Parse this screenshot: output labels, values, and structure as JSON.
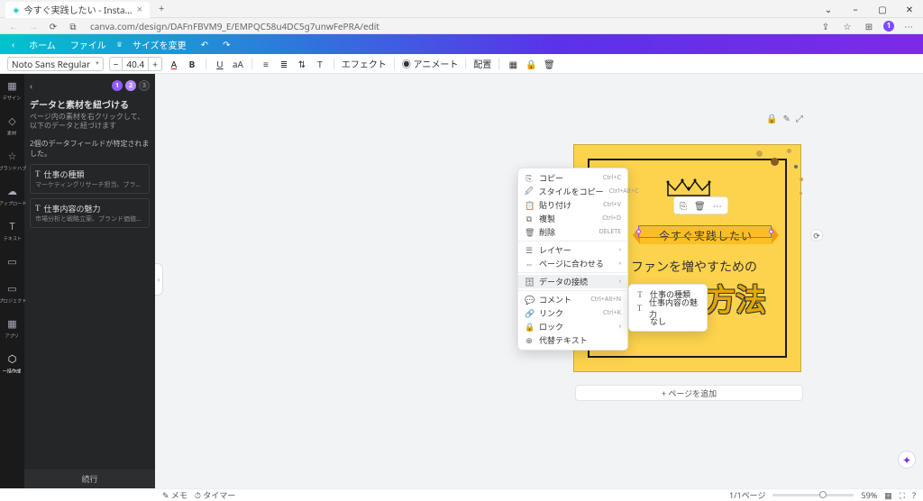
{
  "browser": {
    "tab_title": "今すぐ実践したい - Instagramの投",
    "tab_close": "×",
    "new_tab": "+",
    "url": "canva.com/design/DAFnFBVM9_E/EMPQC58u4DC5g7unwFePRA/edit",
    "profile_initial": "1",
    "win": {
      "min": "–",
      "max": "▢",
      "close": "✕"
    }
  },
  "canva_header": {
    "back": "‹",
    "home": "ホーム",
    "file": "ファイル",
    "resize": "サイズを変更",
    "undo": "↶",
    "redo": "↷"
  },
  "toolbar": {
    "font": "Noto Sans Regular",
    "minus": "−",
    "size": "40.4",
    "plus": "+",
    "color": "A",
    "bold": "B",
    "underline": "U",
    "case": "aA",
    "align": "≡",
    "list": "≣",
    "spacing": "⇅",
    "vtext": "T",
    "effect": "エフェクト",
    "animate": "アニメート",
    "position": "配置",
    "transparent": "▦",
    "lock": "🔒",
    "trash": "🗑"
  },
  "rail": {
    "items": [
      {
        "icon": "▦",
        "label": "デザイン"
      },
      {
        "icon": "◇",
        "label": "素材"
      },
      {
        "icon": "☆",
        "label": "ブランドハブ"
      },
      {
        "icon": "☁",
        "label": "アップロード"
      },
      {
        "icon": "T",
        "label": "テキスト"
      },
      {
        "icon": "▭",
        "label": ""
      },
      {
        "icon": "▭",
        "label": "プロジェクト"
      },
      {
        "icon": "▦",
        "label": "アプリ"
      },
      {
        "icon": "⬡",
        "label": "一括作成"
      }
    ]
  },
  "panel": {
    "back": "‹",
    "steps": [
      "1",
      "2",
      "3"
    ],
    "title": "データと素材を紐づける",
    "desc": "ページ内の素材を右クリックして、以下のデータと紐づけます",
    "confirmed": "2個のデータフィールドが特定されました。",
    "items": [
      {
        "title": "仕事の種類",
        "sub": "マーケティングリサーチ担当、ブランドマネージャー、デ…"
      },
      {
        "title": "仕事内容の魅力",
        "sub": "市場分析と戦略立案、ブランド価値の向上、オンライン広…"
      }
    ],
    "footer": "続行"
  },
  "canvas": {
    "ribbon": "今すぐ実践したい",
    "line2": "ファンを増やすための",
    "line3": "方法",
    "addpage": "+ ページを追加",
    "page_icons": [
      "🔒",
      "✎",
      "⤢"
    ],
    "elem_icons": [
      "⎘",
      "🗑",
      "⋯"
    ],
    "refresh": "⟳",
    "collapse": "‹"
  },
  "context_menu": {
    "items": [
      {
        "icon": "⎘",
        "label": "コピー",
        "shortcut": "Ctrl+C"
      },
      {
        "icon": "🖉",
        "label": "スタイルをコピー",
        "shortcut": "Ctrl+Alt+C"
      },
      {
        "icon": "📋",
        "label": "貼り付け",
        "shortcut": "Ctrl+V"
      },
      {
        "icon": "⧉",
        "label": "複製",
        "shortcut": "Ctrl+D"
      },
      {
        "icon": "🗑",
        "label": "削除",
        "shortcut": "DELETE"
      }
    ],
    "items2": [
      {
        "icon": "☰",
        "label": "レイヤー",
        "arrow": "›"
      },
      {
        "icon": "⇔",
        "label": "ページに合わせる",
        "arrow": "›"
      }
    ],
    "active": {
      "icon": "🗄",
      "label": "データの接続",
      "arrow": "›"
    },
    "items3": [
      {
        "icon": "💬",
        "label": "コメント",
        "shortcut": "Ctrl+Alt+N"
      },
      {
        "icon": "🔗",
        "label": "リンク",
        "shortcut": "Ctrl+K"
      },
      {
        "icon": "🔒",
        "label": "ロック",
        "arrow": "›"
      },
      {
        "icon": "⊕",
        "label": "代替テキスト"
      }
    ]
  },
  "submenu": {
    "items": [
      {
        "icon": "T",
        "label": "仕事の種類"
      },
      {
        "icon": "T",
        "label": "仕事内容の魅力"
      },
      {
        "label": "なし"
      }
    ]
  },
  "footer": {
    "notes": "メモ",
    "timer": "タイマー",
    "pages": "1/1ページ",
    "zoom": "59%",
    "grid": "▦",
    "present": "⛶",
    "help": "?"
  },
  "fab": "✦"
}
